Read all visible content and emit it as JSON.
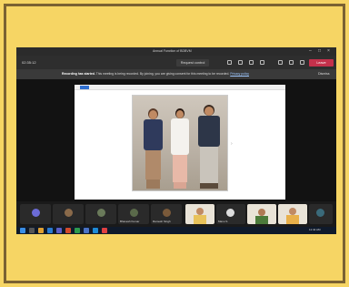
{
  "window": {
    "title": "Annual Function of BDBVM"
  },
  "toolbar": {
    "left_label": "02:35:12",
    "request_control": "Request control",
    "leave": "Leave"
  },
  "notice": {
    "bold": "Recording has started.",
    "text": "This meeting is being recorded. By joining, you are giving consent for this meeting to be recorded.",
    "link": "Privacy policy",
    "dismiss": "Dismiss"
  },
  "stage": {
    "presenter_label": "Anil Sajwan"
  },
  "participants": [
    {
      "name": "",
      "color": "#6b6bd6"
    },
    {
      "name": "",
      "color": "#8a6a4a"
    },
    {
      "name": "",
      "color": "#6a7a5a"
    },
    {
      "name": "Bhavesh Kumar",
      "color": "#5a6a4a"
    },
    {
      "name": "Ramesh Singh",
      "color": "#7a5a3a"
    },
    {
      "name": "",
      "color": "#3a6a7a"
    }
  ],
  "video_tiles": [
    {
      "name": ""
    },
    {
      "name": "Manu S"
    },
    {
      "name": ""
    },
    {
      "name": ""
    }
  ],
  "taskbar": {
    "time": "11:42 AM"
  },
  "colors": {
    "background": "#f6d564",
    "frame": "#7a6232",
    "leave_button": "#c4314b"
  }
}
